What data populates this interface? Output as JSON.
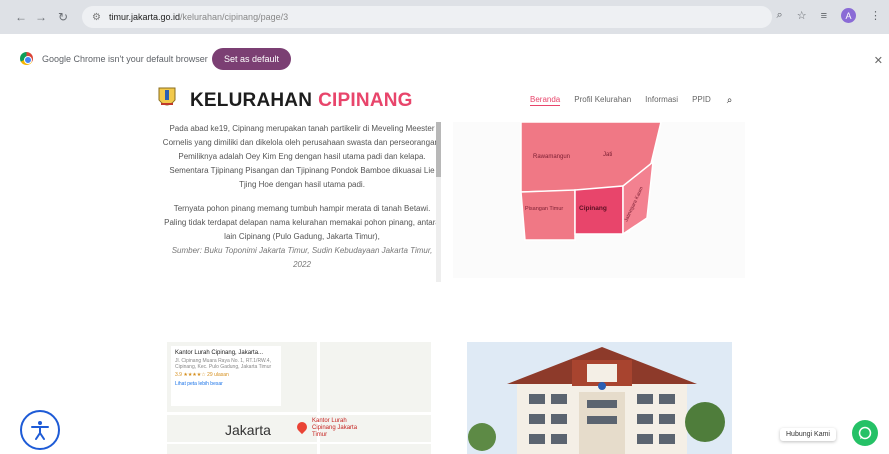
{
  "browser": {
    "url_host": "timur.jakarta.go.id",
    "url_path": "/kelurahan/cipinang/page/3",
    "profile_initial": "A",
    "infobar_message": "Google Chrome isn't your default browser",
    "set_default_label": "Set as default"
  },
  "header": {
    "brand_1": "KELURAHAN",
    "brand_2": "CIPINANG",
    "nav": [
      "Beranda",
      "Profil Kelurahan",
      "Informasi",
      "PPID"
    ]
  },
  "article": {
    "para1": "Pada abad ke19, Cipinang merupakan tanah partikelir di Meveling Meester Cornelis yang dimiliki dan dikelola oleh perusahaan swasta dan perseorangan. Pemiliknya adalah Oey Kim Eng dengan hasil utama padi dan kelapa. Sementara Tjipinang Pisangan dan Tjipinang Pondok Bamboe dikuasai Lie Tjing Hoe dengan hasil utama padi.",
    "para2": "Ternyata pohon pinang memang tumbuh hampir merata di tanah Betawi. Paling tidak terdapat delapan nama kelurahan memakai pohon pinang, antara lain Cipinang (Pulo Gadung, Jakarta Timur),",
    "source": "Sumber: Buku Toponimi Jakarta Timur, Sudin Kebudayaan Jakarta Timur, 2022"
  },
  "map": {
    "regions": [
      "Rawamangun",
      "Jati",
      "Pisangan Timur",
      "Cipinang",
      "Jatinegara Kaum"
    ]
  },
  "gmap": {
    "place_title": "Kantor Lurah Cipinang, Jakarta...",
    "place_address": "Jl. Cipinang Muara Raya No. 1, RT.1/RW.4, Cipinang, Kec. Pulo Gadung, Jakarta Timur",
    "rating": "3.9 ★★★★☆  29 ulasan",
    "enlarge": "Lihat peta lebih besar",
    "city": "Jakarta",
    "pin_label": "Kantor Lurah Cipinang Jakarta Timur"
  },
  "widgets": {
    "chat_label": "Hubungi Kami"
  },
  "colors": {
    "accent": "#e8456b",
    "map_fill": "#f07885",
    "map_highlight": "#e8456b",
    "button_purple": "#7b3f73",
    "whatsapp": "#25c166",
    "a11y_blue": "#1e5bd6"
  }
}
